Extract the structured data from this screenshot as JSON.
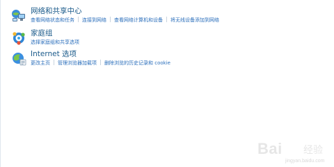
{
  "categories": [
    {
      "title": "网络和共享中心",
      "icon": "network-icon",
      "links": [
        "查看网络状态和任务",
        "连接到网络",
        "查看网络计算机和设备",
        "将无线设备添加到网络"
      ]
    },
    {
      "title": "家庭组",
      "icon": "homegroup-icon",
      "links": [
        "选择家庭组和共享选项"
      ]
    },
    {
      "title": "Internet 选项",
      "icon": "internet-options-icon",
      "links": [
        "更改主页",
        "管理浏览器加载项",
        "删除浏览的历史记录和 cookie"
      ]
    }
  ],
  "watermark": {
    "brand": "Bai",
    "brand2": "经验",
    "url": "jingyan.baidu.com"
  },
  "colors": {
    "title": "#1a5a8a",
    "link": "#2a6ebb",
    "separator": "#c8d3de",
    "background": "#ffffff"
  }
}
